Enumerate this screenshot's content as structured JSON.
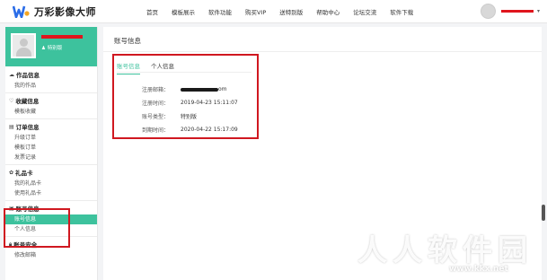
{
  "brand": {
    "name": "万彩影像大师"
  },
  "nav": [
    "首页",
    "模板展示",
    "软件功能",
    "购买VIP",
    "送特别版",
    "帮助中心",
    "论坛交流",
    "软件下载"
  ],
  "user": {
    "badge": "特别版"
  },
  "sidebar": {
    "sections": [
      {
        "title": "作品信息",
        "icon": "cloud-icon",
        "items": [
          "我的作品"
        ]
      },
      {
        "title": "收藏信息",
        "icon": "heart-icon",
        "items": [
          "模板收藏"
        ]
      },
      {
        "title": "订单信息",
        "icon": "cart-icon",
        "items": [
          "升级订单",
          "模板订单",
          "发票记录"
        ]
      },
      {
        "title": "礼品卡",
        "icon": "gift-icon",
        "items": [
          "我的礼品卡",
          "使用礼品卡"
        ]
      },
      {
        "title": "账号信息",
        "icon": "id-card-icon",
        "items": [
          "账号信息",
          "个人信息"
        ],
        "active_item": "账号信息"
      },
      {
        "title": "账号安全",
        "icon": "lock-icon",
        "items": [
          "修改邮箱"
        ]
      }
    ]
  },
  "main": {
    "title": "账号信息",
    "tabs": [
      "账号信息",
      "个人信息"
    ],
    "active_tab": "账号信息",
    "fields": [
      {
        "label": "注册邮箱：",
        "value": "om",
        "redacted": true
      },
      {
        "label": "注册时间：",
        "value": "2019-04-23 15:11:07"
      },
      {
        "label": "账号类型：",
        "value": "特别版"
      },
      {
        "label": "到期时间：",
        "value": "2020-04-22 15:17:09"
      }
    ]
  },
  "watermark": {
    "text": "人人软件园",
    "url": "www.kkx.net"
  },
  "colors": {
    "accent": "#3dc29d",
    "highlight": "#d01820",
    "redaction": "#e0151d"
  }
}
